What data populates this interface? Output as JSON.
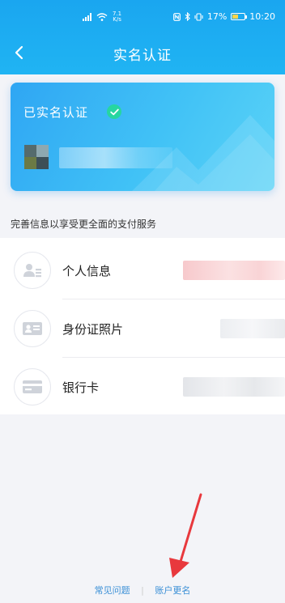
{
  "status_bar": {
    "speed_value": "7.1",
    "speed_unit": "K/s",
    "battery": "17%",
    "time": "10:20"
  },
  "nav": {
    "title": "实名认证"
  },
  "card": {
    "title": "已实名认证"
  },
  "section": {
    "subtitle": "完善信息以享受更全面的支付服务"
  },
  "items": [
    {
      "label": "个人信息",
      "icon": "person-card-icon"
    },
    {
      "label": "身份证照片",
      "icon": "id-card-icon"
    },
    {
      "label": "银行卡",
      "icon": "bank-card-icon"
    }
  ],
  "footer": {
    "faq": "常见问题",
    "rename": "账户更名"
  },
  "colors": {
    "header_blue": "#1aa6f0",
    "verified_green": "#26d6a0",
    "link_blue": "#3a8fd6",
    "annotation_red": "#e8383d"
  }
}
